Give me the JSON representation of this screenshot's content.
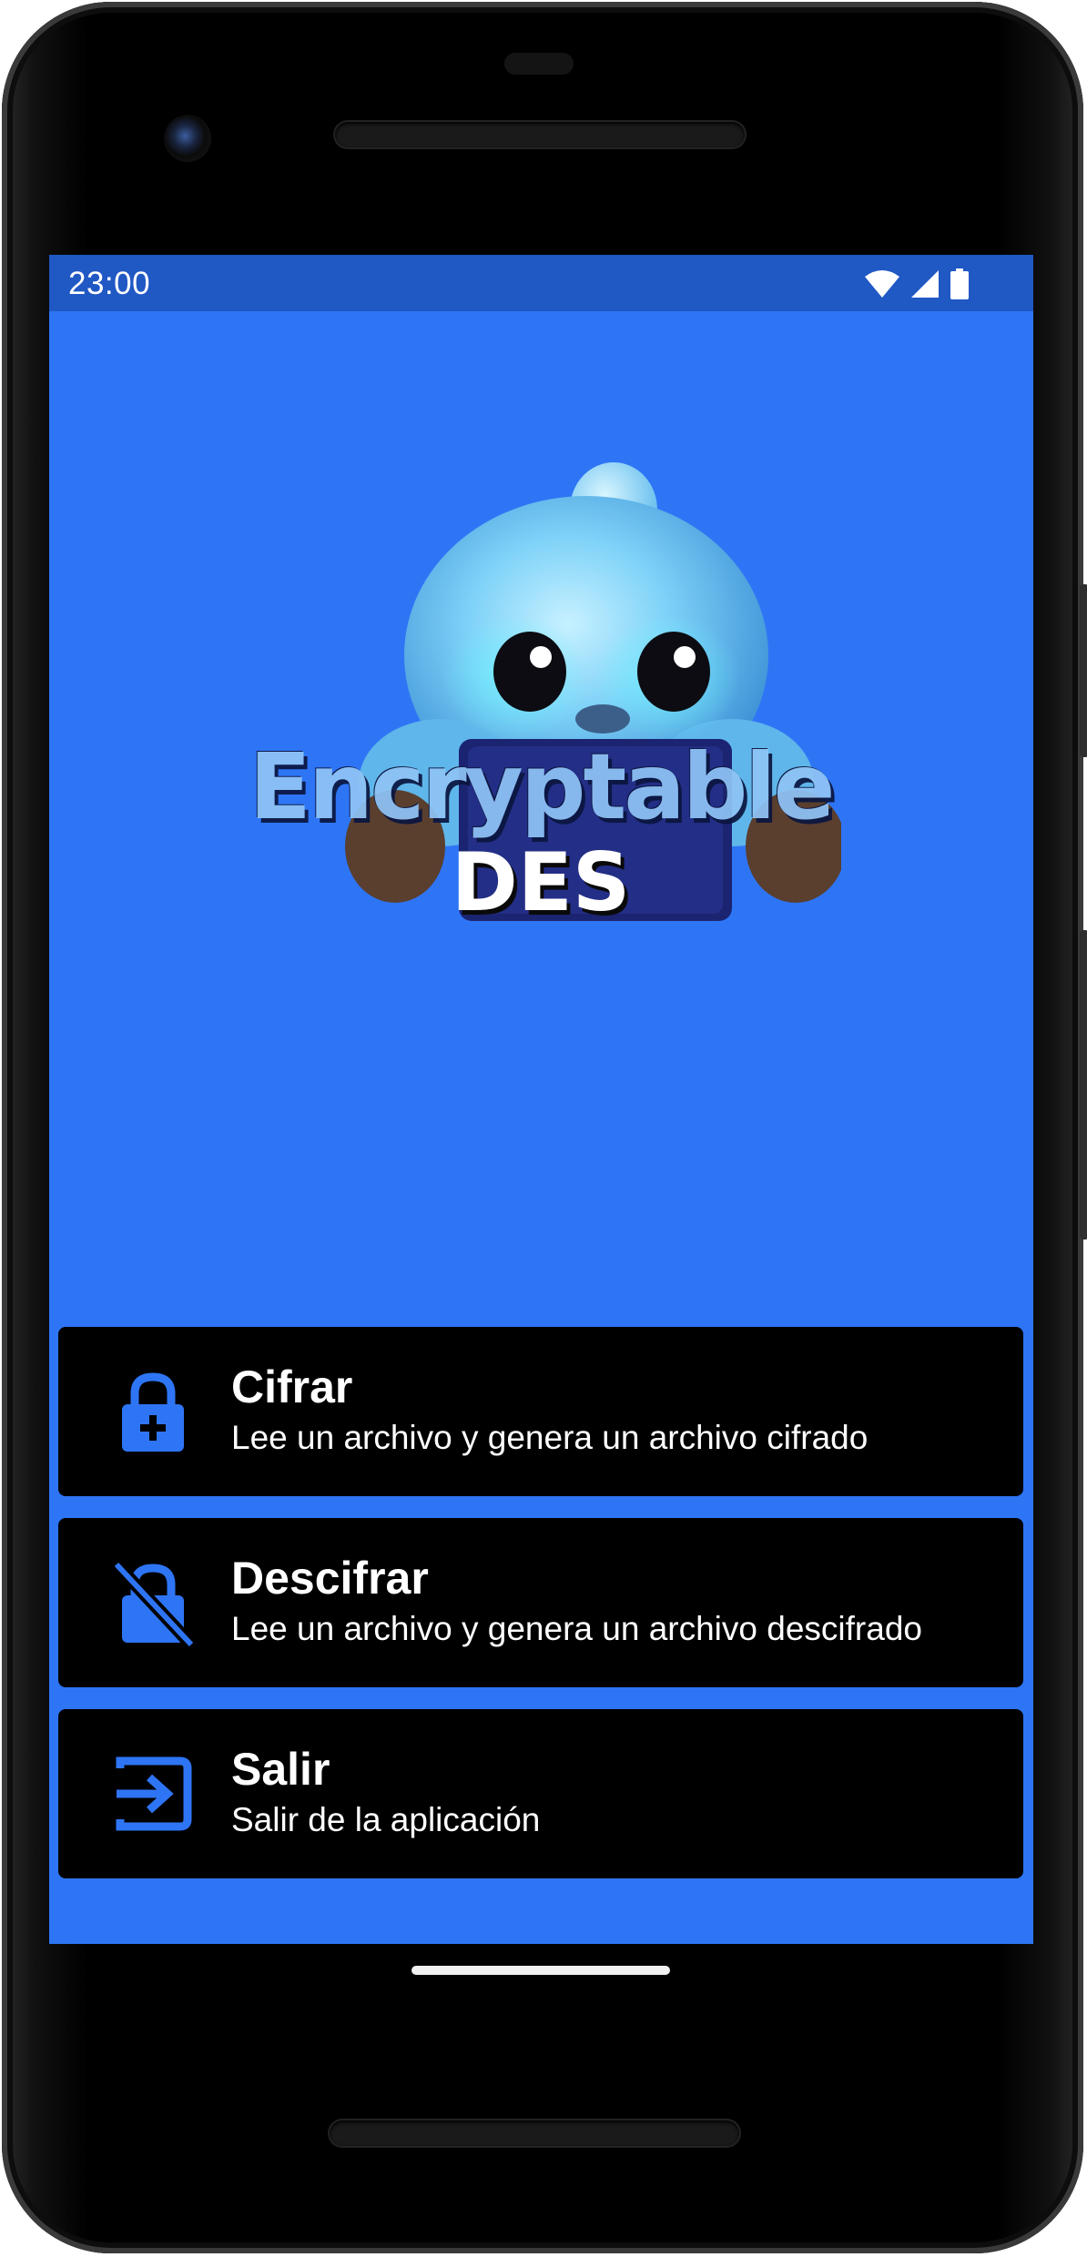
{
  "status_bar": {
    "time": "23:00",
    "icons": [
      "wifi-icon",
      "cell-signal-icon",
      "battery-icon"
    ],
    "background": "#2058c4"
  },
  "app": {
    "background": "#2e75f5",
    "logo": {
      "title": "Encryptable",
      "subtitle": "DES"
    },
    "menu": [
      {
        "title": "Cifrar",
        "description": "Lee un archivo y genera un archivo cifrado",
        "icon": "lock-plus-icon"
      },
      {
        "title": "Descifrar",
        "description": "Lee un archivo y genera un archivo descifrado",
        "icon": "lock-off-icon"
      },
      {
        "title": "Salir",
        "description": "Salir de la aplicación",
        "icon": "exit-icon"
      }
    ],
    "accent": "#2e75f5",
    "card_color": "#000000"
  }
}
